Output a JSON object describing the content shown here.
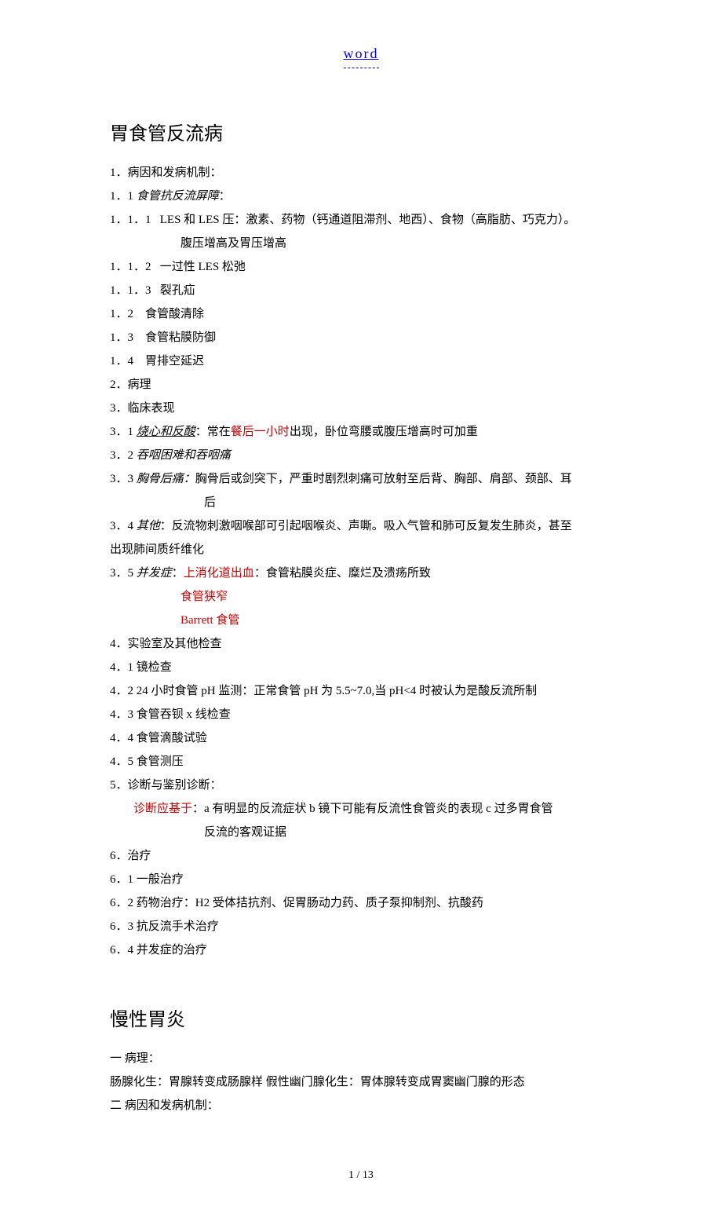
{
  "header": {
    "link": "word"
  },
  "section1": {
    "title": "胃食管反流病",
    "l1": "1．病因和发病机制：",
    "l2_a": "1．1 ",
    "l2_b": "食管抗反流屏障",
    "l2_c": "：",
    "l3_a": "1．1．1",
    "l3_b": "LES 和 LES 压：激素、药物（钙通道阻滞剂、地西）、食物（高脂肪、巧克力）。",
    "l3_sub": "腹压增高及胃压增高",
    "l4_a": "1．1．2",
    "l4_b": "一过性 LES 松弛",
    "l5_a": "1．1．3",
    "l5_b": "裂孔疝",
    "l6_a": "1．2",
    "l6_b": "食管酸清除",
    "l7_a": "1．3",
    "l7_b": "食管粘膜防御",
    "l8_a": "1．4",
    "l8_b": "胃排空延迟",
    "l9": "2．病理",
    "l10": "3．临床表现",
    "l11_a": "3．1 ",
    "l11_b": "烧心和反酸",
    "l11_c": "：常在",
    "l11_d": "餐后一小时",
    "l11_e": "出现，卧位弯腰或腹压增高时可加重",
    "l12_a": "3．2 ",
    "l12_b": "吞咽困难和吞咽痛",
    "l13_a": "3．3 ",
    "l13_b": "胸骨后痛：",
    "l13_c": "胸骨后或剑突下，严重时剧烈刺痛可放射至后背、胸部、肩部、颈部、耳",
    "l13_sub": "后",
    "l14_a": "3．4 ",
    "l14_b": "其他",
    "l14_c": "：反流物刺激咽喉部可引起咽喉炎、声嘶。吸入气管和肺可反复发生肺炎，甚至",
    "l14_sub": "出现肺间质纤维化",
    "l15_a": "3．5 ",
    "l15_b": "并发症",
    "l15_c": "：",
    "l15_d": "上消化道出血",
    "l15_e": "：食管粘膜炎症、糜烂及溃疡所致",
    "l15_sub1": "食管狭窄",
    "l15_sub2": "Barrett 食管",
    "l16": "4．实验室及其他检查",
    "l17": "4．1 镜检查",
    "l18": "4．2 24 小时食管 pH 监测：正常食管 pH 为 5.5~7.0,当 pH<4 时被认为是酸反流所制",
    "l19": "4．3 食管吞钡 x 线检查",
    "l20": "4．4 食管滴酸试验",
    "l21": "4．5 食管测压",
    "l22": "5．诊断与鉴别诊断：",
    "l23_a": "诊断应基于",
    "l23_b": "：a 有明显的反流症状  b 镜下可能有反流性食管炎的表现  c 过多胃食管",
    "l23_sub": "反流的客观证据",
    "l24": "6．治疗",
    "l25": "6．1 一般治疗",
    "l26": "6．2 药物治疗：H2 受体拮抗剂、促胃肠动力药、质子泵抑制剂、抗酸药",
    "l27": "6．3 抗反流手术治疗",
    "l28": "6．4 并发症的治疗"
  },
  "section2": {
    "title": "慢性胃炎",
    "l1": "一 病理：",
    "l2": "肠腺化生：胃腺转变成肠腺样    假性幽门腺化生：胃体腺转变成胃窦幽门腺的形态",
    "l3": "二 病因和发病机制："
  },
  "footer": {
    "page": "1 / 13"
  }
}
